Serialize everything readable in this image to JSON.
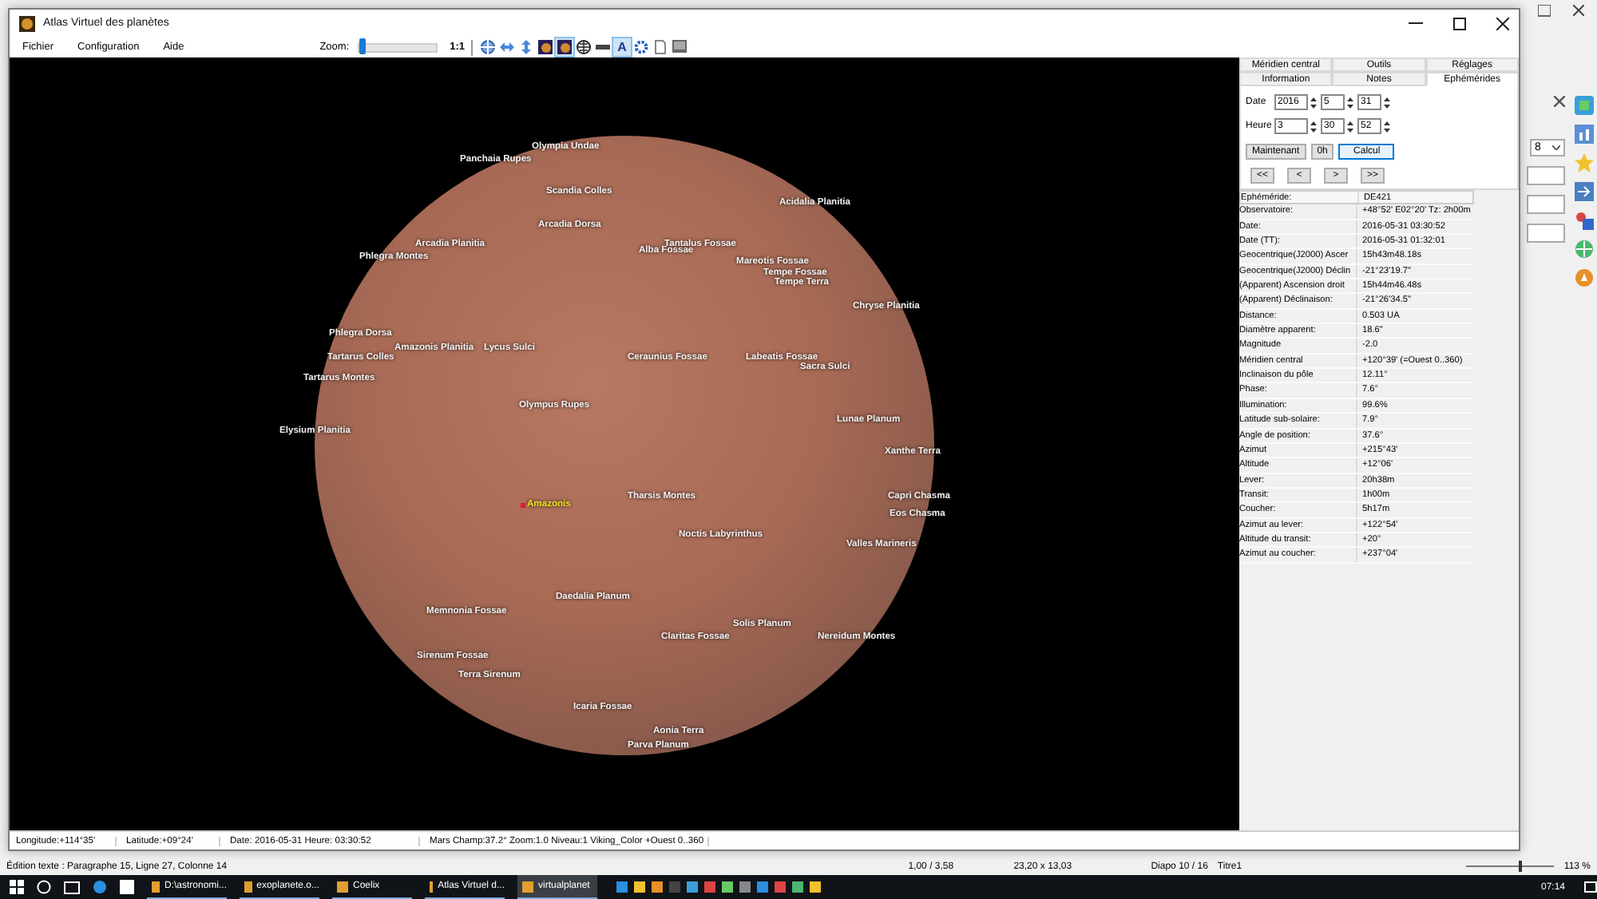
{
  "window": {
    "title": "Atlas Virtuel des planètes"
  },
  "menu": [
    "Fichier",
    "Configuration",
    "Aide"
  ],
  "toolbar": {
    "zoom_label": "Zoom:",
    "zoom": {
      "level": 0.02
    },
    "ratio": "1:1",
    "tools": [
      {
        "kind": "target",
        "selected": false
      },
      {
        "kind": "hflip",
        "selected": false
      },
      {
        "kind": "vflip",
        "selected": false
      },
      {
        "kind": "photo",
        "selected": false
      },
      {
        "kind": "photo",
        "selected": true
      },
      {
        "kind": "grid",
        "selected": false
      },
      {
        "kind": "ruler",
        "selected": false
      },
      {
        "kind": "glyph",
        "text": "A",
        "selected": true
      },
      {
        "kind": "gear",
        "selected": false
      },
      {
        "kind": "page",
        "selected": false
      },
      {
        "kind": "screen",
        "selected": false
      }
    ]
  },
  "map": {
    "labels": [
      {
        "name": "Olympia Undae",
        "highlighted": false
      },
      {
        "name": "Panchaia Rupes",
        "highlighted": false
      },
      {
        "name": "Scandia Colles",
        "highlighted": false
      },
      {
        "name": "Acidalia Planitia",
        "highlighted": false
      },
      {
        "name": "Arcadia Dorsa",
        "highlighted": false
      },
      {
        "name": "Arcadia Planitia",
        "highlighted": false
      },
      {
        "name": "Phlegra Montes",
        "highlighted": false
      },
      {
        "name": "Alba Fossae",
        "highlighted": false
      },
      {
        "name": "Tantalus Fossae",
        "highlighted": false
      },
      {
        "name": "Mareotis Fossae",
        "highlighted": false
      },
      {
        "name": "Tempe Fossae",
        "highlighted": false
      },
      {
        "name": "Tempe Terra",
        "highlighted": false
      },
      {
        "name": "Chryse Planitia",
        "highlighted": false
      },
      {
        "name": "Phlegra Dorsa",
        "highlighted": false
      },
      {
        "name": "Amazonis Planitia",
        "highlighted": false
      },
      {
        "name": "Lycus Sulci",
        "highlighted": false
      },
      {
        "name": "Tartarus Colles",
        "highlighted": false
      },
      {
        "name": "Tartarus Montes",
        "highlighted": false
      },
      {
        "name": "Ceraunius Fossae",
        "highlighted": false
      },
      {
        "name": "Labeatis Fossae",
        "highlighted": false
      },
      {
        "name": "Sacra Sulci",
        "highlighted": false
      },
      {
        "name": "Olympus Rupes",
        "highlighted": false
      },
      {
        "name": "Elysium Planitia",
        "highlighted": false
      },
      {
        "name": "Lunae Planum",
        "highlighted": false
      },
      {
        "name": "Xanthe Terra",
        "highlighted": false
      },
      {
        "name": "Amazonis",
        "highlighted": true
      },
      {
        "name": "Tharsis Montes",
        "highlighted": false
      },
      {
        "name": "Capri Chasma",
        "highlighted": false
      },
      {
        "name": "Eos Chasma",
        "highlighted": false
      },
      {
        "name": "Noctis Labyrinthus",
        "highlighted": false
      },
      {
        "name": "Valles Marineris",
        "highlighted": false
      },
      {
        "name": "Daedalia Planum",
        "highlighted": false
      },
      {
        "name": "Memnonia Fossae",
        "highlighted": false
      },
      {
        "name": "Solis Planum",
        "highlighted": false
      },
      {
        "name": "Claritas Fossae",
        "highlighted": false
      },
      {
        "name": "Nereidum Montes",
        "highlighted": false
      },
      {
        "name": "Sirenum Fossae",
        "highlighted": false
      },
      {
        "name": "Terra Sirenum",
        "highlighted": false
      },
      {
        "name": "Icaria Fossae",
        "highlighted": false
      },
      {
        "name": "Aonia Terra",
        "highlighted": false
      },
      {
        "name": "Parva Planum",
        "highlighted": false
      }
    ]
  },
  "panel": {
    "tabs_top": [
      {
        "label": "Méridien central",
        "selected": false
      },
      {
        "label": "Outils",
        "selected": false
      },
      {
        "label": "Réglages",
        "selected": false
      }
    ],
    "tabs_bottom": [
      {
        "label": "Information",
        "selected": false
      },
      {
        "label": "Notes",
        "selected": false
      },
      {
        "label": "Ephémérides",
        "selected": true
      }
    ],
    "date": {
      "label": "Date",
      "fields": [
        "2016",
        "5",
        "31"
      ]
    },
    "time": {
      "label": "Heure",
      "fields": [
        "3",
        "30",
        "52"
      ]
    },
    "buttons": [
      {
        "label": "Maintenant",
        "selected": false
      },
      {
        "label": "0h",
        "selected": false
      },
      {
        "label": "Calcul",
        "selected": true
      }
    ],
    "nav": [
      "<<",
      "<",
      ">",
      ">>"
    ],
    "table": {
      "columns": [
        "Ephéméride:",
        "DE421"
      ],
      "rows": [
        [
          "Observatoire:",
          "+48°52' E02°20' Tz:  2h00m"
        ],
        [
          "Date:",
          "2016-05-31 03:30:52"
        ],
        [
          "Date (TT):",
          "2016-05-31 01:32:01"
        ],
        [
          "Geocentrique(J2000) Ascer",
          "15h43m48.18s"
        ],
        [
          "Geocentrique(J2000) Déclin",
          "-21°23'19.7\""
        ],
        [
          "(Apparent) Ascension droit",
          "15h44m46.48s"
        ],
        [
          "(Apparent) Déclinaison:",
          "-21°26'34.5\""
        ],
        [
          "Distance:",
          "0.503 UA"
        ],
        [
          "Diamètre apparent:",
          "18.6\""
        ],
        [
          "Magnitude",
          "-2.0"
        ],
        [
          "Méridien central",
          "+120°39' (=Ouest 0..360)"
        ],
        [
          "Inclinaison du pôle",
          "12.11°"
        ],
        [
          "Phase:",
          "7.6°"
        ],
        [
          "Illumination:",
          "99.6%"
        ],
        [
          "Latitude sub-solaire:",
          "7.9°"
        ],
        [
          "Angle de position:",
          "37.6°"
        ],
        [
          "Azimut",
          "+215°43'"
        ],
        [
          "Altitude",
          "+12°06'"
        ],
        [
          "Lever:",
          "20h38m"
        ],
        [
          "Transit:",
          "1h00m"
        ],
        [
          "Coucher:",
          "5h17m"
        ],
        [
          "Azimut au lever:",
          "+122°54'"
        ],
        [
          "Altitude du transit:",
          "+20°"
        ],
        [
          "Azimut au coucher:",
          "+237°04'"
        ]
      ]
    }
  },
  "status_bar": [
    "Longitude:+114°35'",
    "Latitude:+09°24'",
    "Date: 2016-05-31  Heure: 03:30:52",
    "Mars Champ:37.2° Zoom:1.0  Niveau:1 Viking_Color  +Ouest 0..360"
  ],
  "background_app": {
    "dropdown_value": "8",
    "status_left": "Édition texte : Paragraphe 15, Ligne 27, Colonne 14",
    "position": "1,00 / 3,58",
    "size": "23,20 x 13,03",
    "slide": "Diapo 10 / 16",
    "layout": "Titre1",
    "zoom": {
      "level": 0.6
    },
    "zoom_percent": "113 %"
  },
  "taskbar": {
    "items": [
      {
        "label": "D:\\astronomi...",
        "selected": false
      },
      {
        "label": "exoplanete.o...",
        "selected": false
      },
      {
        "label": "Coelix",
        "selected": false
      },
      {
        "label": "Atlas Virtuel d...",
        "selected": false
      },
      {
        "label": "virtualplanet",
        "selected": true
      }
    ],
    "clock": "07:14"
  }
}
